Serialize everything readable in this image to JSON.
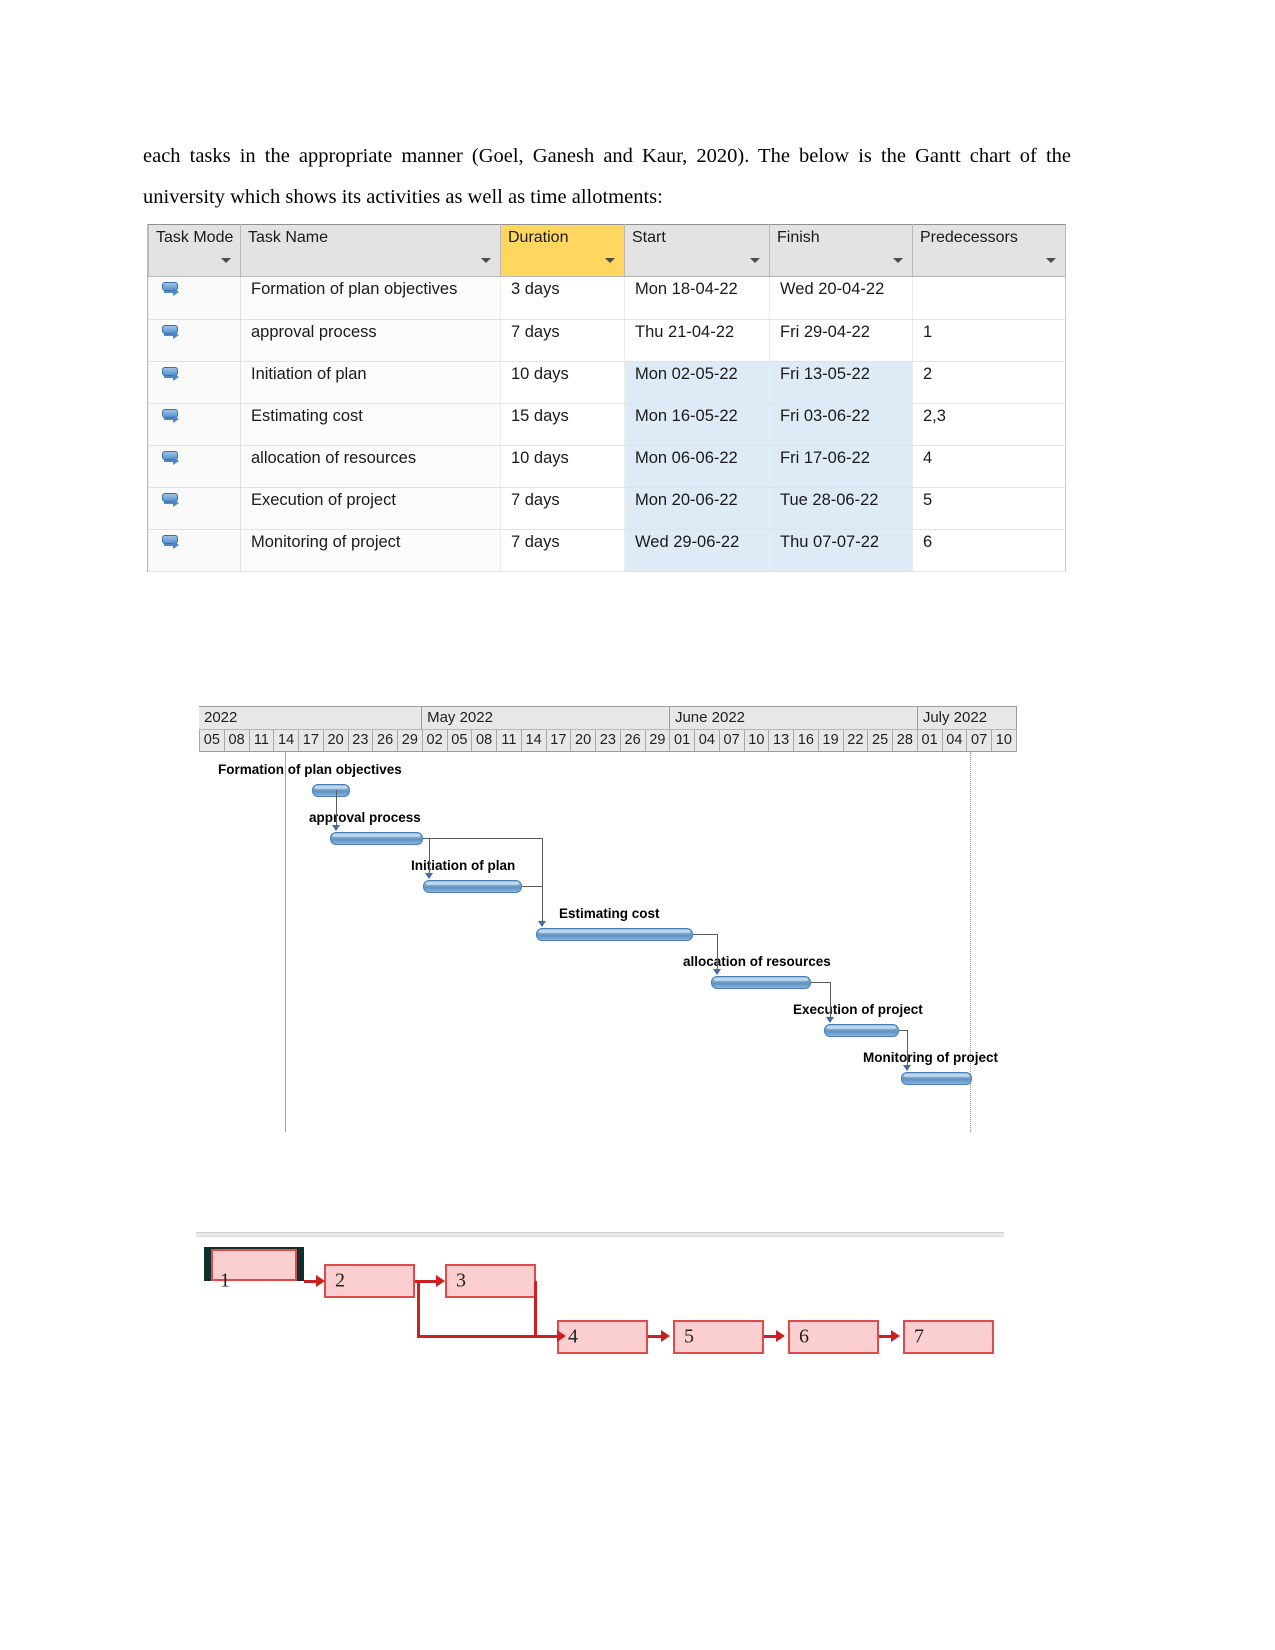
{
  "paragraph": {
    "text": "each tasks in the appropriate manner (Goel, Ganesh and Kaur, 2020). The below is the Gantt chart of the university which shows its activities as well as time allotments:"
  },
  "task_table": {
    "columns": [
      {
        "label": "Task Mode",
        "highlight": "none"
      },
      {
        "label": "Task Name",
        "highlight": "none"
      },
      {
        "label": "Duration",
        "highlight": "yellow"
      },
      {
        "label": "Start",
        "highlight": "none"
      },
      {
        "label": "Finish",
        "highlight": "none"
      },
      {
        "label": "Predecessors",
        "highlight": "none"
      }
    ],
    "highlight_color": "#ffd75e",
    "selection_color": "#dfeaf7",
    "rows": [
      {
        "mode": "auto-schedule",
        "name": "Formation of plan objectives",
        "duration": "3 days",
        "start": "Mon 18-04-22",
        "finish": "Wed 20-04-22",
        "predecessors": ""
      },
      {
        "mode": "auto-schedule",
        "name": "approval process",
        "duration": "7 days",
        "start": "Thu 21-04-22",
        "finish": "Fri 29-04-22",
        "predecessors": "1"
      },
      {
        "mode": "auto-schedule",
        "name": "Initiation of plan",
        "duration": "10 days",
        "start": "Mon 02-05-22",
        "finish": "Fri 13-05-22",
        "predecessors": "2"
      },
      {
        "mode": "auto-schedule",
        "name": "Estimating cost",
        "duration": "15 days",
        "start": "Mon 16-05-22",
        "finish": "Fri 03-06-22",
        "predecessors": "2,3"
      },
      {
        "mode": "auto-schedule",
        "name": "allocation of resources",
        "duration": "10 days",
        "start": "Mon 06-06-22",
        "finish": "Fri 17-06-22",
        "predecessors": "4"
      },
      {
        "mode": "auto-schedule",
        "name": "Execution of project",
        "duration": "7 days",
        "start": "Mon 20-06-22",
        "finish": "Tue 28-06-22",
        "predecessors": "5"
      },
      {
        "mode": "auto-schedule",
        "name": "Monitoring of project",
        "duration": "7 days",
        "start": "Wed 29-06-22",
        "finish": "Thu 07-07-22",
        "predecessors": "6"
      }
    ]
  },
  "gantt": {
    "months": [
      "2022",
      "May 2022",
      "June 2022",
      "July 2022"
    ],
    "days": [
      "05",
      "08",
      "11",
      "14",
      "17",
      "20",
      "23",
      "26",
      "29",
      "02",
      "05",
      "08",
      "11",
      "14",
      "17",
      "20",
      "23",
      "26",
      "29",
      "01",
      "04",
      "07",
      "10",
      "13",
      "16",
      "19",
      "22",
      "25",
      "28",
      "01",
      "04",
      "07",
      "10"
    ],
    "bars": [
      {
        "label": "Formation of plan objectives",
        "start": "Mon 18-04-22",
        "finish": "Wed 20-04-22",
        "duration": "3 days"
      },
      {
        "label": "approval process",
        "start": "Thu 21-04-22",
        "finish": "Fri 29-04-22",
        "duration": "7 days"
      },
      {
        "label": "Initiation of plan",
        "start": "Mon 02-05-22",
        "finish": "Fri 13-05-22",
        "duration": "10 days"
      },
      {
        "label": "Estimating cost",
        "start": "Mon 16-05-22",
        "finish": "Fri 03-06-22",
        "duration": "15 days"
      },
      {
        "label": "allocation of resources",
        "start": "Mon 06-06-22",
        "finish": "Fri 17-06-22",
        "duration": "10 days"
      },
      {
        "label": "Execution of project",
        "start": "Mon 20-06-22",
        "finish": "Tue 28-06-22",
        "duration": "7 days"
      },
      {
        "label": "Monitoring of project",
        "start": "Wed 29-06-22",
        "finish": "Thu 07-07-22",
        "duration": "7 days"
      }
    ],
    "bar_color": "#5e92c4",
    "today_line_color": "#d9a24a"
  },
  "network": {
    "node_fill": "#fbcfcf",
    "node_border": "#e04a4a",
    "link_color": "#d01f20",
    "nodes": [
      {
        "id": "1",
        "critical": true
      },
      {
        "id": "2",
        "critical": false
      },
      {
        "id": "3",
        "critical": false
      },
      {
        "id": "4",
        "critical": false
      },
      {
        "id": "5",
        "critical": false
      },
      {
        "id": "6",
        "critical": false
      },
      {
        "id": "7",
        "critical": false
      }
    ],
    "links": [
      [
        "1",
        "2"
      ],
      [
        "2",
        "3"
      ],
      [
        "2",
        "4"
      ],
      [
        "3",
        "4"
      ],
      [
        "4",
        "5"
      ],
      [
        "5",
        "6"
      ],
      [
        "6",
        "7"
      ]
    ]
  }
}
